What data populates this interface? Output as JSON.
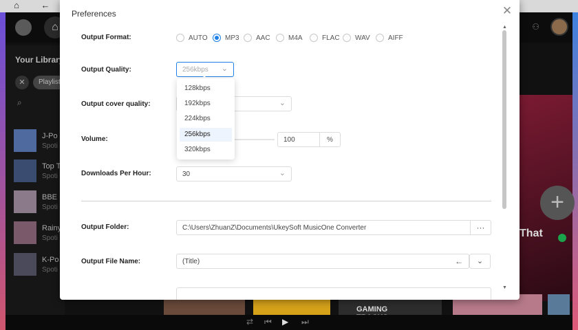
{
  "dialog": {
    "title": "Preferences",
    "close_icon": "close-icon",
    "output_format": {
      "label": "Output Format:",
      "options": [
        "AUTO",
        "MP3",
        "AAC",
        "M4A",
        "FLAC",
        "WAV",
        "AIFF"
      ],
      "selected": "MP3"
    },
    "output_quality": {
      "label": "Output Quality:",
      "value": "256kbps",
      "dropdown_open": true,
      "options": [
        "128kbps",
        "192kbps",
        "224kbps",
        "256kbps",
        "320kbps"
      ],
      "highlighted": "256kbps"
    },
    "cover_quality": {
      "label": "Output cover quality:"
    },
    "volume": {
      "label": "Volume:",
      "value": "100",
      "unit": "%"
    },
    "downloads_per_hour": {
      "label": "Downloads Per Hour:",
      "value": "30"
    },
    "output_folder": {
      "label": "Output Folder:",
      "value": "C:\\Users\\ZhuanZ\\Documents\\UkeySoft MusicOne Converter",
      "browse_label": "···"
    },
    "output_file_name": {
      "label": "Output File Name:",
      "value": "(Title)",
      "back_icon": "arrow-left-icon",
      "expand_icon": "chevron-down-icon"
    }
  },
  "background": {
    "library_title": "Your Library",
    "filter_chip": "Playlist",
    "playlists": [
      {
        "title": "J-Po",
        "subtitle": "Spoti"
      },
      {
        "title": "Top T",
        "subtitle": "Spoti"
      },
      {
        "title": "BBE",
        "subtitle": "Spoti"
      },
      {
        "title": "Rainy",
        "subtitle": "Spoti"
      },
      {
        "title": "K-Po",
        "subtitle": "Spoti"
      }
    ],
    "banner_text": "That",
    "tile_text": "GAMING\nTRACKS"
  },
  "colors": {
    "accent": "#1e7fe6",
    "dialog_bg": "#ffffff",
    "dropdown_highlight": "#eef4fd"
  }
}
